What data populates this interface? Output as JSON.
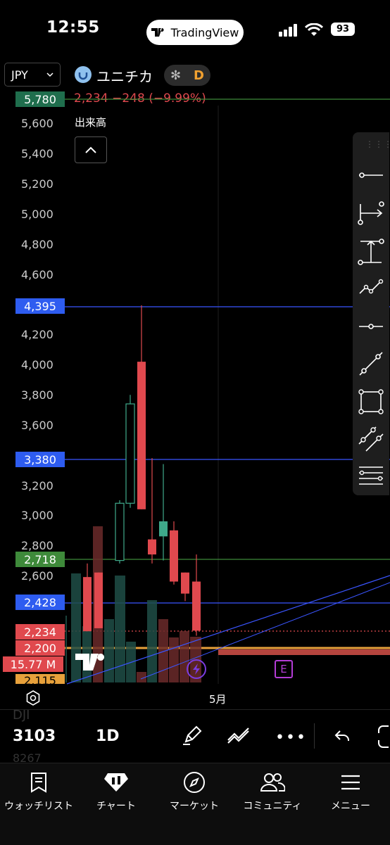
{
  "status_bar": {
    "time": "12:55",
    "app_name": "TradingView",
    "battery": "93"
  },
  "header": {
    "currency": "JPY",
    "symbol": "ユニチカ",
    "interval_badge": "D",
    "last_price": "2,234",
    "change": "−248",
    "change_pct": "(−9.99%)",
    "volume_label": "出来高"
  },
  "price_axis": {
    "ticks": [
      "5,600",
      "5,400",
      "5,200",
      "5,000",
      "4,800",
      "4,600",
      "4,200",
      "4,000",
      "3,800",
      "3,600",
      "3,200",
      "3,000",
      "2,800",
      "2,600"
    ],
    "labels": [
      {
        "text": "5,780",
        "color": "#1f6e4d"
      },
      {
        "text": "4,395",
        "color": "#2e5cf0"
      },
      {
        "text": "3,380",
        "color": "#2e5cf0"
      },
      {
        "text": "2,718",
        "color": "#3e8a3a"
      },
      {
        "text": "2,428",
        "color": "#2e5cf0"
      },
      {
        "text": "2,234",
        "color": "#e0494e"
      },
      {
        "text": "2,200",
        "color": "#e0494e"
      },
      {
        "text": "15.77 M",
        "color": "#e0494e"
      },
      {
        "text": "2,115",
        "color": "#e8a13b"
      }
    ]
  },
  "chart_data": {
    "type": "candlestick",
    "y_unit": "JPY",
    "ylim": [
      2115,
      5780
    ],
    "x_label_visible": "5月",
    "candles": [
      {
        "open": 2590,
        "high": 2680,
        "low": 2230,
        "close": 2230
      },
      {
        "open": 2620,
        "high": 2620,
        "low": 2250,
        "close": 2250
      },
      {
        "open": 2700,
        "high": 3100,
        "low": 2680,
        "close": 3080
      },
      {
        "open": 3080,
        "high": 3800,
        "low": 3050,
        "close": 3740
      },
      {
        "open": 4020,
        "high": 4395,
        "low": 3040,
        "close": 3040
      },
      {
        "open": 2840,
        "high": 3380,
        "low": 2680,
        "close": 2740
      },
      {
        "open": 2860,
        "high": 3340,
        "low": 2700,
        "close": 2960
      },
      {
        "open": 2900,
        "high": 2960,
        "low": 2540,
        "close": 2560
      },
      {
        "open": 2620,
        "high": 2620,
        "low": 2430,
        "close": 2480
      },
      {
        "open": 2560,
        "high": 2740,
        "low": 2200,
        "close": 2234
      }
    ],
    "horizontal_lines": [
      {
        "price": 5780,
        "color": "#3e8a3a"
      },
      {
        "price": 4395,
        "color": "#3a55ff"
      },
      {
        "price": 3380,
        "color": "#3a55ff"
      },
      {
        "price": 2718,
        "color": "#3e8a3a"
      },
      {
        "price": 2428,
        "color": "#3a55ff"
      },
      {
        "price": 2234,
        "color": "#e0494e"
      },
      {
        "price": 2200,
        "color": "#e8a13b"
      }
    ]
  },
  "toolbar_icons": [
    "trendline-icon",
    "date-range-icon",
    "price-range-icon",
    "path-icon",
    "horizontal-ray-icon",
    "ray-icon",
    "rectangle-icon",
    "parallel-channel-icon",
    "fib-lines-icon"
  ],
  "bottom_bar": {
    "ticker_faint_top": "DJI",
    "ticker": "3103",
    "ticker_faint_bottom": "8267",
    "interval": "1D",
    "earnings_badge": "E"
  },
  "nav": {
    "items": [
      {
        "label": "ウォッチリスト"
      },
      {
        "label": "チャート"
      },
      {
        "label": "マーケット"
      },
      {
        "label": "コミュニティ"
      },
      {
        "label": "メニュー"
      }
    ]
  }
}
